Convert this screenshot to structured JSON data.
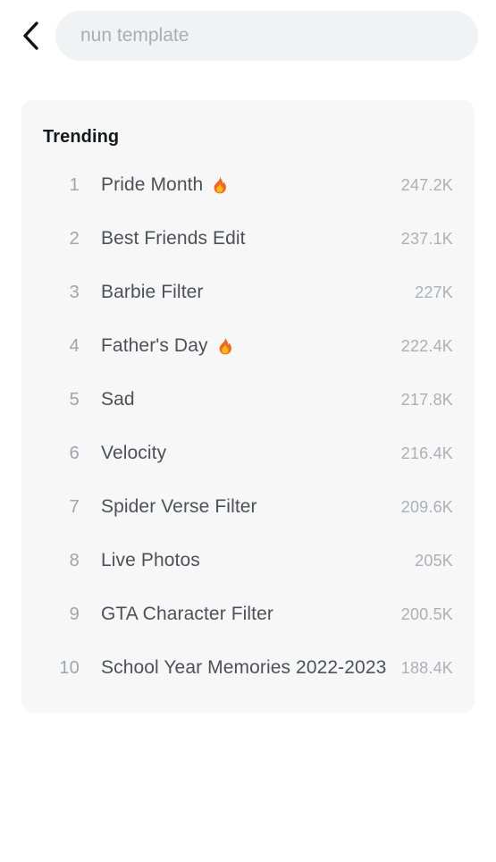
{
  "header": {
    "back_icon": "chevron-left-icon",
    "search": {
      "value": "",
      "placeholder": "nun template"
    }
  },
  "trending": {
    "title": "Trending",
    "flame_icon": "fire-icon",
    "flame_color": "#F26522",
    "items": [
      {
        "rank": "1",
        "title": "Pride Month",
        "count": "247.2K",
        "hot": true
      },
      {
        "rank": "2",
        "title": "Best Friends Edit",
        "count": "237.1K",
        "hot": false
      },
      {
        "rank": "3",
        "title": "Barbie Filter",
        "count": "227K",
        "hot": false
      },
      {
        "rank": "4",
        "title": "Father's Day",
        "count": "222.4K",
        "hot": true
      },
      {
        "rank": "5",
        "title": "Sad",
        "count": "217.8K",
        "hot": false
      },
      {
        "rank": "6",
        "title": "Velocity",
        "count": "216.4K",
        "hot": false
      },
      {
        "rank": "7",
        "title": "Spider Verse Filter",
        "count": "209.6K",
        "hot": false
      },
      {
        "rank": "8",
        "title": "Live Photos",
        "count": "205K",
        "hot": false
      },
      {
        "rank": "9",
        "title": "GTA Character Filter",
        "count": "200.5K",
        "hot": false
      },
      {
        "rank": "10",
        "title": "School Year Memories 2022-2023",
        "count": "188.4K",
        "hot": false
      }
    ]
  },
  "colors": {
    "page_background": "#ffffff",
    "card_background": "#f7f7f8",
    "search_background": "#f1f2f4",
    "title_text": "#4c5158",
    "rank_text": "#9fa4ac",
    "count_text": "#abb0b7",
    "heading_text": "#16181c"
  }
}
